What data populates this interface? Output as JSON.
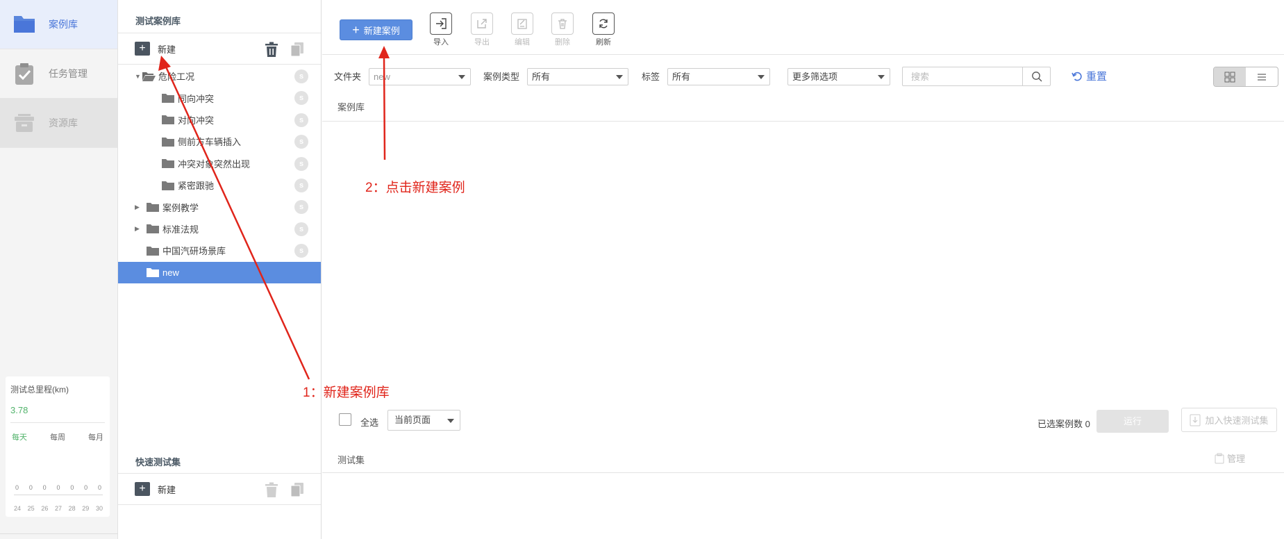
{
  "nav": {
    "items": [
      {
        "label": "案例库",
        "icon": "folder-icon",
        "active": true
      },
      {
        "label": "任务管理",
        "icon": "clipboard-check-icon",
        "active": false
      },
      {
        "label": "资源库",
        "icon": "archive-box-icon",
        "active": false
      }
    ]
  },
  "stats": {
    "title": "测试总里程(km)",
    "value": "3.78",
    "tabs": [
      "每天",
      "每周",
      "每月"
    ],
    "active_tab": "每天",
    "values": [
      "0",
      "0",
      "0",
      "0",
      "0",
      "0",
      "0"
    ],
    "days": [
      "24",
      "25",
      "26",
      "27",
      "28",
      "29",
      "30"
    ]
  },
  "library": {
    "title": "测试案例库",
    "new_label": "新建",
    "tree": [
      {
        "label": "危险工况",
        "level": 0,
        "expanded": true,
        "has_toggle": true
      },
      {
        "label": "同向冲突",
        "level": 1
      },
      {
        "label": "对向冲突",
        "level": 1
      },
      {
        "label": "侧前方车辆插入",
        "level": 1
      },
      {
        "label": "冲突对象突然出现",
        "level": 1
      },
      {
        "label": "紧密跟驰",
        "level": 1
      },
      {
        "label": "案例教学",
        "level": 0,
        "expanded": false,
        "has_toggle": true
      },
      {
        "label": "标准法规",
        "level": 0,
        "expanded": false,
        "has_toggle": true
      },
      {
        "label": "中国汽研场景库",
        "level": 0,
        "has_toggle": false
      },
      {
        "label": "new",
        "level": 0,
        "has_toggle": false,
        "selected": true
      }
    ]
  },
  "quickset": {
    "title": "快速测试集",
    "new_label": "新建"
  },
  "toolbar": {
    "new_case_label": "新建案例",
    "tools": [
      {
        "label": "导入",
        "icon": "import-icon",
        "enabled": true
      },
      {
        "label": "导出",
        "icon": "export-icon",
        "enabled": false
      },
      {
        "label": "编辑",
        "icon": "edit-icon",
        "enabled": false
      },
      {
        "label": "删除",
        "icon": "delete-icon",
        "enabled": false
      },
      {
        "label": "刷新",
        "icon": "refresh-icon",
        "enabled": true
      }
    ]
  },
  "filters": {
    "folder_label": "文件夹",
    "folder_value": "new",
    "type_label": "案例类型",
    "type_value": "所有",
    "tag_label": "标签",
    "tag_value": "所有",
    "more_label": "更多筛选项",
    "search_placeholder": "搜索",
    "reset_label": "重置"
  },
  "main": {
    "library_section": "案例库",
    "select_all_label": "全选",
    "page_scope": "当前页面",
    "selected_count_label": "已选案例数 0",
    "run_label": "运行",
    "quick_add_label": "加入快速测试集",
    "testset_section": "测试集",
    "manage_label": "管理"
  },
  "annotations": {
    "step1": "1：新建案例库",
    "step2": "2：点击新建案例",
    "color": "#e0251b"
  },
  "colors": {
    "accent": "#5b8de0",
    "positive": "#52b36b"
  }
}
